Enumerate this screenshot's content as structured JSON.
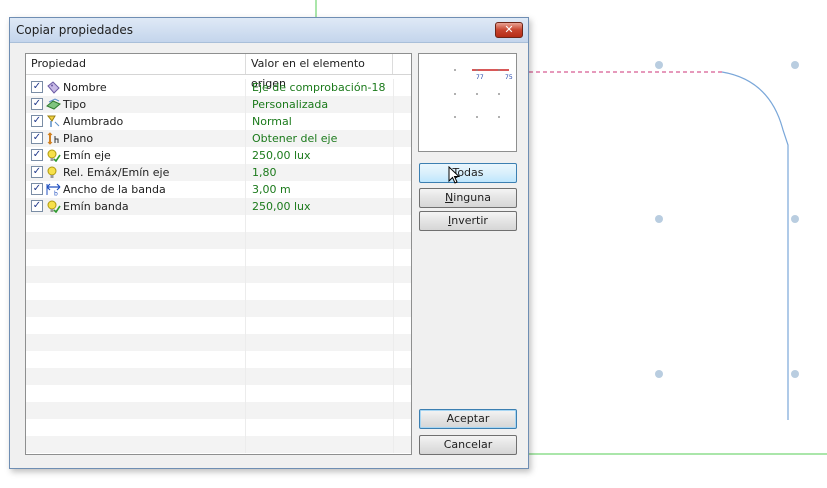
{
  "dialog": {
    "title": "Copiar propiedades",
    "close_glyph": "✕"
  },
  "list": {
    "headers": [
      "Propiedad",
      "Valor en el elemento origen"
    ],
    "rows": [
      {
        "label": "Nombre",
        "value": "Eje de comprobación-18",
        "checked": true,
        "icon": "tag-icon"
      },
      {
        "label": "Tipo",
        "value": "Personalizada",
        "checked": true,
        "icon": "type-icon"
      },
      {
        "label": "Alumbrado",
        "value": "Normal",
        "checked": true,
        "icon": "lighting-icon"
      },
      {
        "label": "Plano",
        "value": "Obtener del eje",
        "checked": true,
        "icon": "plane-icon"
      },
      {
        "label": "Emín eje",
        "value": "250,00 lux",
        "checked": true,
        "icon": "bulb-icon"
      },
      {
        "label": "Rel. Emáx/Emín eje",
        "value": "1,80",
        "checked": true,
        "icon": "bulb-icon"
      },
      {
        "label": "Ancho de la banda",
        "value": "3,00 m",
        "checked": true,
        "icon": "width-icon"
      },
      {
        "label": "Emín banda",
        "value": "250,00 lux",
        "checked": true,
        "icon": "bulb-icon"
      }
    ]
  },
  "preview": {
    "labels": [
      "77",
      "75"
    ]
  },
  "buttons": {
    "all": {
      "pre": "",
      "accel": "T",
      "post": "odas"
    },
    "none": {
      "pre": "",
      "accel": "N",
      "post": "inguna"
    },
    "invert": {
      "pre": "",
      "accel": "I",
      "post": "nvertir"
    },
    "ok": "Aceptar",
    "cancel": "Cancelar"
  },
  "colors": {
    "value_text": "#1b7a1b",
    "grid_point": "#b9cde0",
    "axis_line": "#7aa7d9",
    "dashed_line": "#cc3377",
    "green_line": "#55cc55"
  }
}
